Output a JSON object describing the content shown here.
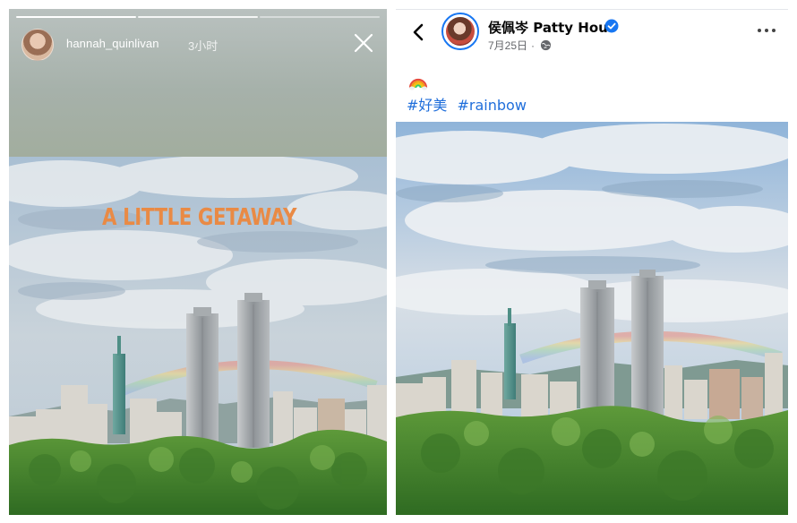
{
  "story": {
    "username": "hannah_quinlivan",
    "time": "3小时",
    "caption": "A LITTLE GETAWAY",
    "progress_segments": [
      {
        "state": "done"
      },
      {
        "state": "active"
      },
      {
        "state": "pending"
      }
    ],
    "icons": {
      "close": "close-icon"
    }
  },
  "post": {
    "author": "侯佩岑 Patty Hou",
    "date": "7月25日",
    "separator": "·",
    "emoji": "rainbow-emoji",
    "hashtags": [
      "#好美",
      "#rainbow"
    ],
    "icons": {
      "back": "chevron-left-icon",
      "verified": "verified-badge-icon",
      "privacy": "globe-icon",
      "more": "more-options-icon"
    }
  },
  "colors": {
    "story_caption": "#e98a45",
    "link": "#216fdb",
    "verified": "#1877f2",
    "meta_text": "#65676b"
  }
}
